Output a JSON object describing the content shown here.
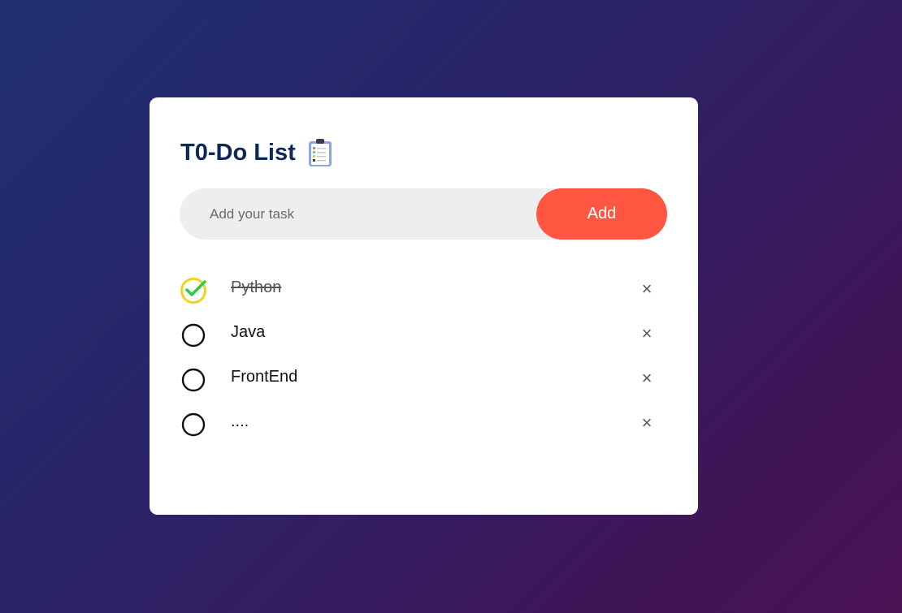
{
  "app": {
    "title": "T0-Do List",
    "title_icon": "clipboard-icon"
  },
  "input": {
    "placeholder": "Add your task",
    "value": ""
  },
  "add_button": {
    "label": "Add",
    "color": "#ff5642"
  },
  "tasks": [
    {
      "text": "Python",
      "checked": true
    },
    {
      "text": "Java",
      "checked": false
    },
    {
      "text": "FrontEnd",
      "checked": false
    },
    {
      "text": "....",
      "checked": false
    }
  ],
  "icons": {
    "checked": "check-circle-icon",
    "unchecked": "empty-circle-icon",
    "remove": "close-icon",
    "remove_glyph": "×"
  },
  "colors": {
    "title": "#0d2856",
    "check_ring": "#f2d21b",
    "check_mark": "#2ecc40"
  }
}
